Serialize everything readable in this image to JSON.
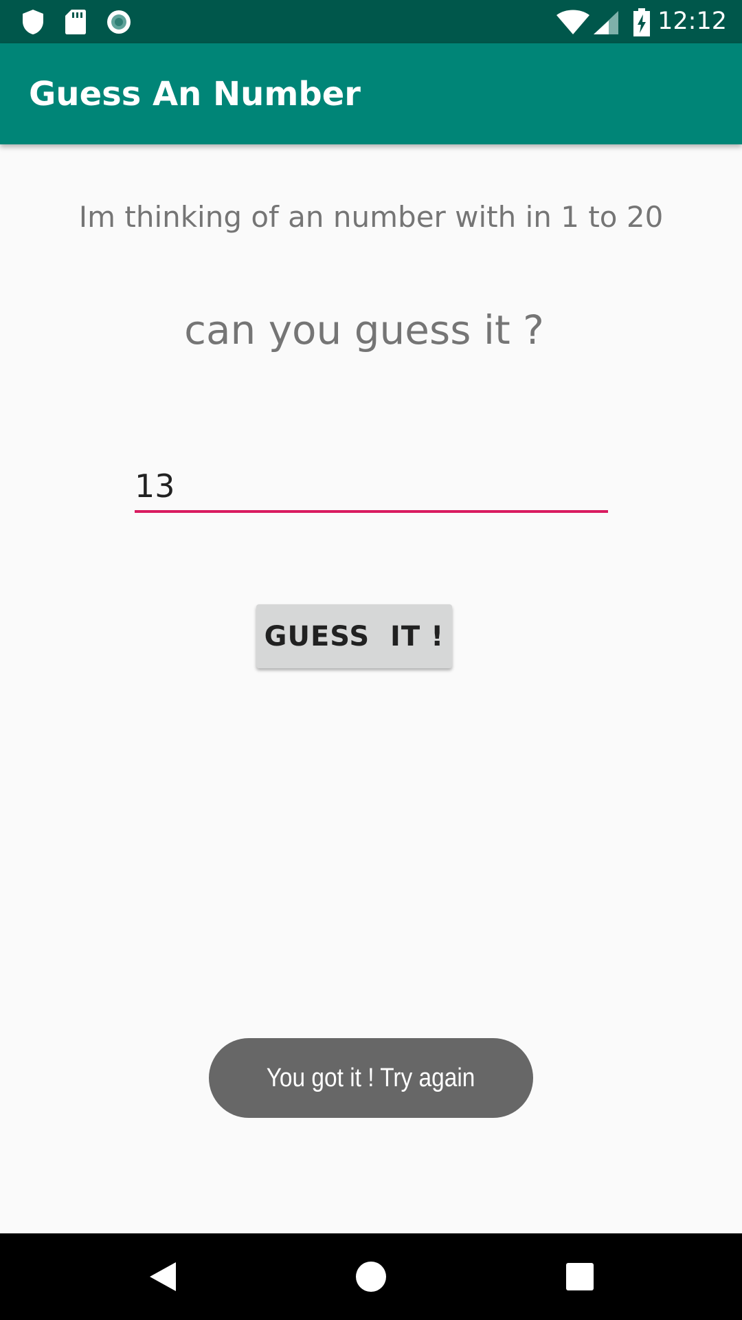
{
  "status_bar": {
    "time": "12:12",
    "icons": [
      "shield-icon",
      "sd-card-icon",
      "record-icon",
      "wifi-icon",
      "signal-icon",
      "battery-charging-icon"
    ]
  },
  "app_bar": {
    "title": "Guess An Number",
    "color": "#008577"
  },
  "main": {
    "prompt_line1": "Im thinking of an number with in 1 to 20",
    "prompt_line2": "can you guess it ?",
    "guess_input": {
      "value": "13",
      "accent_color": "#d81b60"
    },
    "guess_button_label": "GUESS  IT !"
  },
  "toast": {
    "message": "You got it ! Try again"
  },
  "nav_bar": {
    "buttons": [
      "back-icon",
      "home-icon",
      "recents-icon"
    ]
  }
}
